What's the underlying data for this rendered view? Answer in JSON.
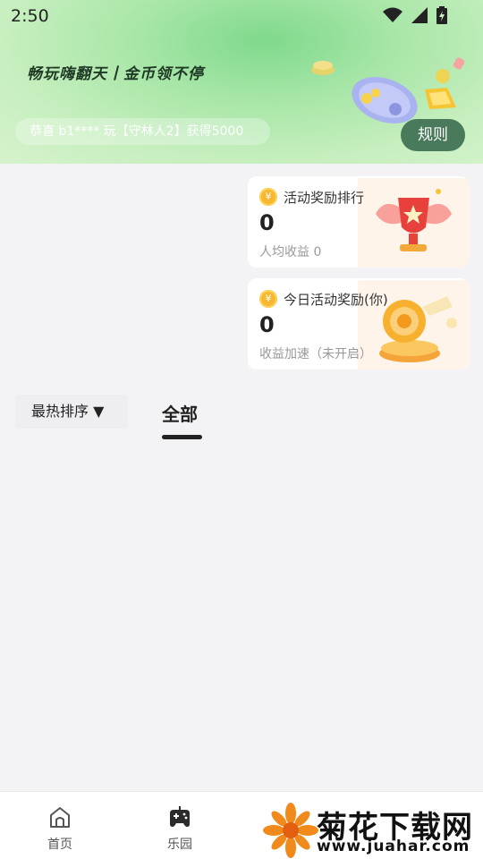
{
  "status_bar": {
    "time": "2:50"
  },
  "hero": {
    "slogan": "畅玩嗨翻天丨金币领不停",
    "ticker": "恭喜 b1**** 玩【守林人2】获得5000",
    "rules_label": "规则"
  },
  "cards": [
    {
      "title": "活动奖励排行",
      "value": "0",
      "sub": "人均收益 0"
    },
    {
      "title": "今日活动奖励(你)",
      "value": "0",
      "sub": "收益加速（未开启）"
    }
  ],
  "coin_symbol": "¥",
  "filters": {
    "sort_label": "最热排序 ▼",
    "tab_all": "全部"
  },
  "bottom_nav": [
    {
      "label": "首页",
      "icon": "home-icon"
    },
    {
      "label": "乐园",
      "icon": "gamepad-icon"
    }
  ],
  "watermark": {
    "title": "菊花下载网",
    "url": "www.juahar.com"
  },
  "colors": {
    "accent_green": "#4a7a5c",
    "coin": "#f7b830",
    "hero_green": "#8fdc95"
  }
}
